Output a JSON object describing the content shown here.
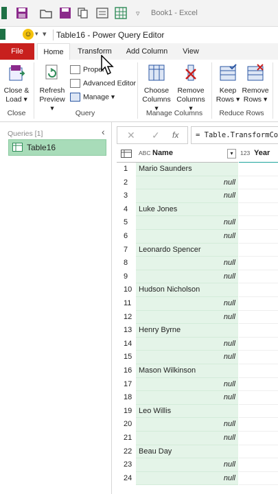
{
  "excel": {
    "title": "Book1 - Excel"
  },
  "window": {
    "title": "Table16 - Power Query Editor"
  },
  "tabs": [
    "File",
    "Home",
    "Transform",
    "Add Column",
    "View"
  ],
  "ribbon": {
    "close_load": [
      "Close &",
      "Load ▾"
    ],
    "refresh_preview": [
      "Refresh",
      "Preview ▾"
    ],
    "properties": "Proper",
    "advanced_editor": "Advanced Editor",
    "manage": "Manage ▾",
    "choose_columns": [
      "Choose",
      "Columns ▾"
    ],
    "remove_columns": [
      "Remove",
      "Columns ▾"
    ],
    "keep_rows": [
      "Keep",
      "Rows ▾"
    ],
    "remove_rows": [
      "Remove",
      "Rows ▾"
    ],
    "groups": {
      "close": "Close",
      "query": "Query",
      "manage_columns": "Manage Columns",
      "reduce_rows": "Reduce Rows"
    }
  },
  "queries": {
    "header": "Queries [1]",
    "items": [
      "Table16"
    ]
  },
  "formula_bar": {
    "fx": "fx",
    "formula": "= Table.TransformCo"
  },
  "grid": {
    "columns": [
      {
        "type": "ABC",
        "name": "Name"
      },
      {
        "type": "123",
        "name": "Year"
      }
    ],
    "rows": [
      {
        "n": "1",
        "name": "Mario Saunders"
      },
      {
        "n": "2",
        "name": "null"
      },
      {
        "n": "3",
        "name": "null"
      },
      {
        "n": "4",
        "name": "Luke Jones"
      },
      {
        "n": "5",
        "name": "null"
      },
      {
        "n": "6",
        "name": "null"
      },
      {
        "n": "7",
        "name": "Leonardo Spencer"
      },
      {
        "n": "8",
        "name": "null"
      },
      {
        "n": "9",
        "name": "null"
      },
      {
        "n": "10",
        "name": "Hudson Nicholson"
      },
      {
        "n": "11",
        "name": "null"
      },
      {
        "n": "12",
        "name": "null"
      },
      {
        "n": "13",
        "name": "Henry Byrne"
      },
      {
        "n": "14",
        "name": "null"
      },
      {
        "n": "15",
        "name": "null"
      },
      {
        "n": "16",
        "name": "Mason Wilkinson"
      },
      {
        "n": "17",
        "name": "null"
      },
      {
        "n": "18",
        "name": "null"
      },
      {
        "n": "19",
        "name": "Leo Willis"
      },
      {
        "n": "20",
        "name": "null"
      },
      {
        "n": "21",
        "name": "null"
      },
      {
        "n": "22",
        "name": "Beau Day"
      },
      {
        "n": "23",
        "name": "null"
      },
      {
        "n": "24",
        "name": "null"
      }
    ]
  },
  "colors": {
    "file_tab": "#c8201e",
    "selected_query": "#a8dcb9",
    "name_column": "#e4f4e8"
  }
}
